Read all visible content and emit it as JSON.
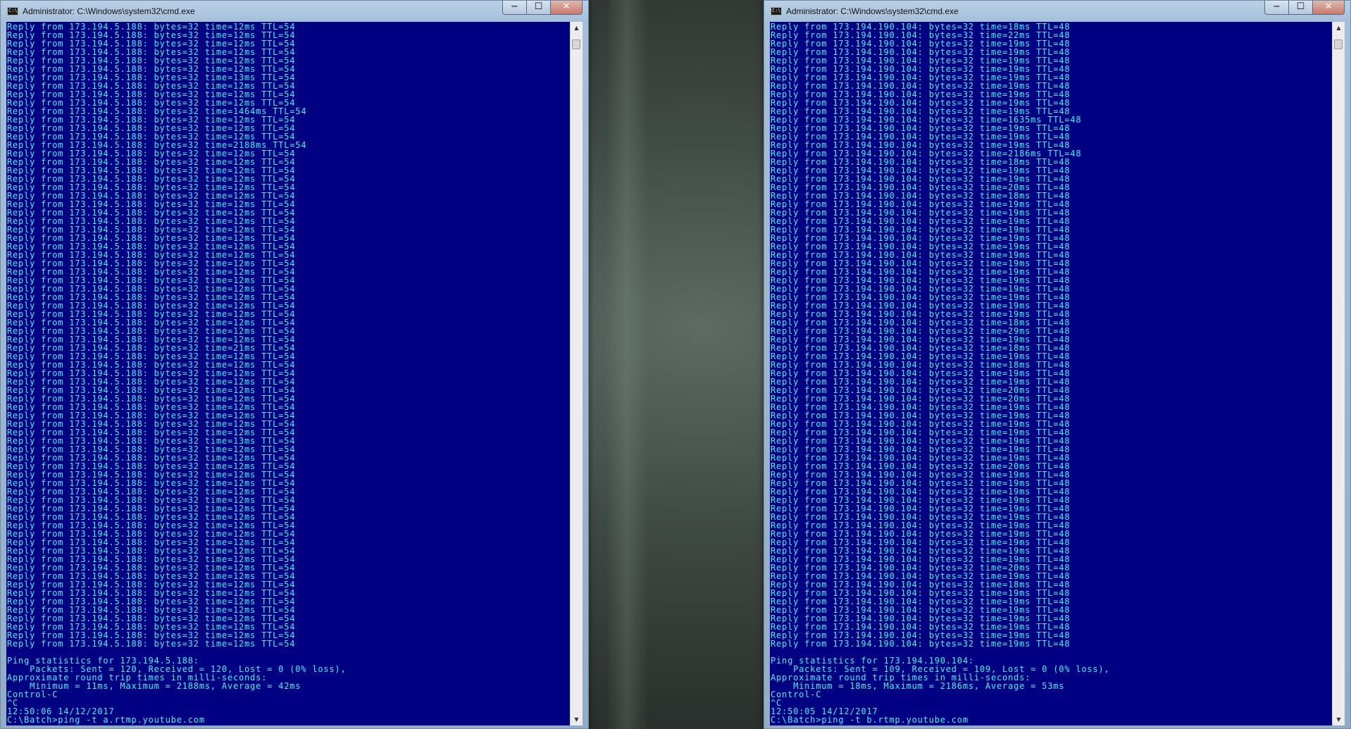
{
  "windows": [
    {
      "title": "Administrator: C:\\Windows\\system32\\cmd.exe",
      "icon_text": "C:\\",
      "reply_ip": "173.194.5.188",
      "times": [
        "12ms",
        "12ms",
        "12ms",
        "12ms",
        "12ms",
        "12ms",
        "13ms",
        "12ms",
        "12ms",
        "12ms",
        "1464ms",
        "12ms",
        "12ms",
        "12ms",
        "2188ms",
        "12ms",
        "12ms",
        "12ms",
        "12ms",
        "12ms",
        "12ms",
        "12ms",
        "12ms",
        "12ms",
        "12ms",
        "12ms",
        "12ms",
        "12ms",
        "12ms",
        "12ms",
        "12ms",
        "12ms",
        "12ms",
        "12ms",
        "12ms",
        "12ms",
        "12ms",
        "12ms",
        "21ms",
        "12ms",
        "12ms",
        "12ms",
        "12ms",
        "12ms",
        "12ms",
        "12ms",
        "12ms",
        "12ms",
        "12ms",
        "13ms",
        "12ms",
        "12ms",
        "12ms",
        "12ms",
        "12ms",
        "12ms",
        "12ms",
        "12ms",
        "12ms",
        "12ms",
        "12ms",
        "12ms",
        "12ms",
        "12ms",
        "12ms",
        "12ms",
        "12ms",
        "12ms",
        "12ms",
        "12ms",
        "12ms",
        "12ms",
        "12ms",
        "12ms"
      ],
      "ttl": "54",
      "stats_lines": [
        "Ping statistics for 173.194.5.188:",
        "    Packets: Sent = 120, Received = 120, Lost = 0 (0% loss),",
        "Approximate round trip times in milli-seconds:",
        "    Minimum = 11ms, Maximum = 2188ms, Average = 42ms",
        "Control-C",
        "^C",
        "12:50:06 14/12/2017",
        "C:\\Batch>ping -t a.rtmp.youtube.com"
      ]
    },
    {
      "title": "Administrator: C:\\Windows\\system32\\cmd.exe",
      "icon_text": "C:\\",
      "reply_ip": "173.194.190.104",
      "times": [
        "18ms",
        "22ms",
        "19ms",
        "19ms",
        "19ms",
        "19ms",
        "19ms",
        "19ms",
        "19ms",
        "19ms",
        "19ms",
        "1635ms",
        "19ms",
        "19ms",
        "19ms",
        "2186ms",
        "18ms",
        "19ms",
        "19ms",
        "20ms",
        "18ms",
        "19ms",
        "19ms",
        "19ms",
        "19ms",
        "19ms",
        "19ms",
        "19ms",
        "19ms",
        "19ms",
        "19ms",
        "19ms",
        "19ms",
        "19ms",
        "19ms",
        "18ms",
        "29ms",
        "19ms",
        "18ms",
        "19ms",
        "18ms",
        "19ms",
        "19ms",
        "20ms",
        "20ms",
        "19ms",
        "19ms",
        "19ms",
        "19ms",
        "19ms",
        "19ms",
        "19ms",
        "20ms",
        "19ms",
        "19ms",
        "19ms",
        "19ms",
        "19ms",
        "19ms",
        "19ms",
        "19ms",
        "19ms",
        "19ms",
        "19ms",
        "20ms",
        "19ms",
        "18ms",
        "19ms",
        "19ms",
        "19ms",
        "19ms",
        "19ms",
        "19ms",
        "19ms"
      ],
      "ttl": "48",
      "stats_lines": [
        "Ping statistics for 173.194.190.104:",
        "    Packets: Sent = 109, Received = 109, Lost = 0 (0% loss),",
        "Approximate round trip times in milli-seconds:",
        "    Minimum = 18ms, Maximum = 2186ms, Average = 53ms",
        "Control-C",
        "^C",
        "12:50:05 14/12/2017",
        "C:\\Batch>ping -t b.rtmp.youtube.com"
      ]
    }
  ],
  "controls": {
    "minimize": "−",
    "maximize": "☐",
    "close": "✕"
  },
  "colors": {
    "console_bg": "#000082",
    "console_text": "#3ff6f2"
  }
}
